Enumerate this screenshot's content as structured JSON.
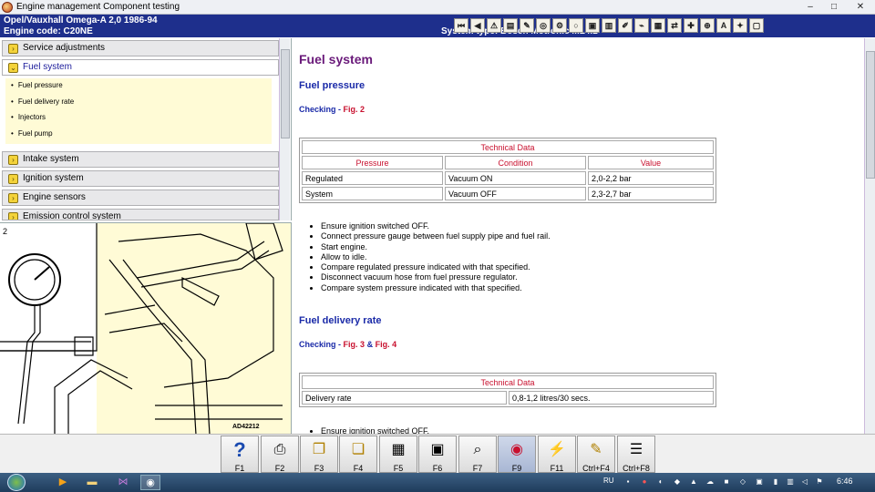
{
  "window": {
    "title": "Engine management Component testing",
    "controls": {
      "minimize": "–",
      "maximize": "□",
      "close": "✕"
    }
  },
  "header": {
    "vehicle": "Opel/Vauxhall   Omega-A  2,0   1986-94",
    "engine_code": "Engine code: C20NE",
    "system_type": "System type: Bosch Motronic ML4.1",
    "toolbar_icons": [
      "first-page-icon",
      "prev-page-icon",
      "warning-icon",
      "rename-icon",
      "edit-icon",
      "camera-icon",
      "chain-icon",
      "printer-icon",
      "bookmark-icon",
      "car-icon",
      "brush-icon",
      "wiring-icon",
      "document-icon",
      "compare-icon",
      "lock-icon",
      "magnifier-icon",
      "letter-a-icon",
      "sparkle-icon",
      "help-icon"
    ]
  },
  "nav": {
    "sections": [
      {
        "label": "Service adjustments",
        "active": false
      },
      {
        "label": "Fuel system",
        "active": true
      },
      {
        "label": "Intake system",
        "active": false
      },
      {
        "label": "Ignition system",
        "active": false
      },
      {
        "label": "Engine sensors",
        "active": false
      },
      {
        "label": "Emission control system",
        "active": false
      }
    ],
    "fuel_subitems": [
      "Fuel pressure",
      "Fuel delivery rate",
      "Injectors",
      "Fuel pump"
    ]
  },
  "figure": {
    "number": "2",
    "ref": "AD42212"
  },
  "content": {
    "title": "Fuel system",
    "pressure": {
      "heading": "Fuel pressure",
      "checking": "Checking",
      "sep": "-",
      "fig": "Fig. 2",
      "table": {
        "caption": "Technical Data",
        "headers": [
          "Pressure",
          "Condition",
          "Value"
        ],
        "rows": [
          [
            "Regulated",
            "Vacuum ON",
            "2,0-2,2 bar"
          ],
          [
            "System",
            "Vacuum OFF",
            "2,3-2,7 bar"
          ]
        ]
      },
      "steps": [
        "Ensure ignition switched OFF.",
        "Connect pressure gauge between fuel supply pipe and fuel rail.",
        "Start engine.",
        "Allow to idle.",
        "Compare regulated pressure indicated with that specified.",
        "Disconnect vacuum hose from fuel pressure regulator.",
        "Compare system pressure indicated with that specified."
      ]
    },
    "delivery": {
      "heading": "Fuel delivery rate",
      "checking": "Checking",
      "sep": "-",
      "fig_a": "Fig. 3",
      "amp": "&",
      "fig_b": "Fig. 4",
      "table": {
        "caption": "Technical Data",
        "rows": [
          [
            "Delivery rate",
            "0,8-1,2 litres/30 secs."
          ]
        ]
      },
      "steps_partial": "Ensure ignition switched OFF."
    }
  },
  "fkeys": [
    {
      "label": "F1",
      "icon": "help-icon",
      "glyph": "?"
    },
    {
      "label": "F2",
      "icon": "printer-icon",
      "glyph": "⎙"
    },
    {
      "label": "F3",
      "icon": "copy-icon",
      "glyph": "❐"
    },
    {
      "label": "F4",
      "icon": "paste-icon",
      "glyph": "❏"
    },
    {
      "label": "F5",
      "icon": "diagram-icon",
      "glyph": "▦"
    },
    {
      "label": "F6",
      "icon": "module-icon",
      "glyph": "▣"
    },
    {
      "label": "F7",
      "icon": "zoom-icon",
      "glyph": "⌕"
    },
    {
      "label": "F9",
      "icon": "gauge-icon",
      "glyph": "◉"
    },
    {
      "label": "F11",
      "icon": "probe-icon",
      "glyph": "⚡"
    },
    {
      "label": "Ctrl+F4",
      "icon": "note-icon",
      "glyph": "✎"
    },
    {
      "label": "Ctrl+F8",
      "icon": "list-icon",
      "glyph": "☰"
    }
  ],
  "taskbar": {
    "language": "RU",
    "clock": "6:46",
    "apps": [
      "media-player-icon",
      "folder-icon",
      "visual-studio-icon",
      "browser-icon"
    ]
  },
  "colors": {
    "header_blue": "#1e2f8c",
    "heading_purple": "#6a1a7a",
    "heading_blue": "#1a2aa8",
    "accent_red": "#c8102e",
    "panel_yellow": "#fffbd6"
  }
}
